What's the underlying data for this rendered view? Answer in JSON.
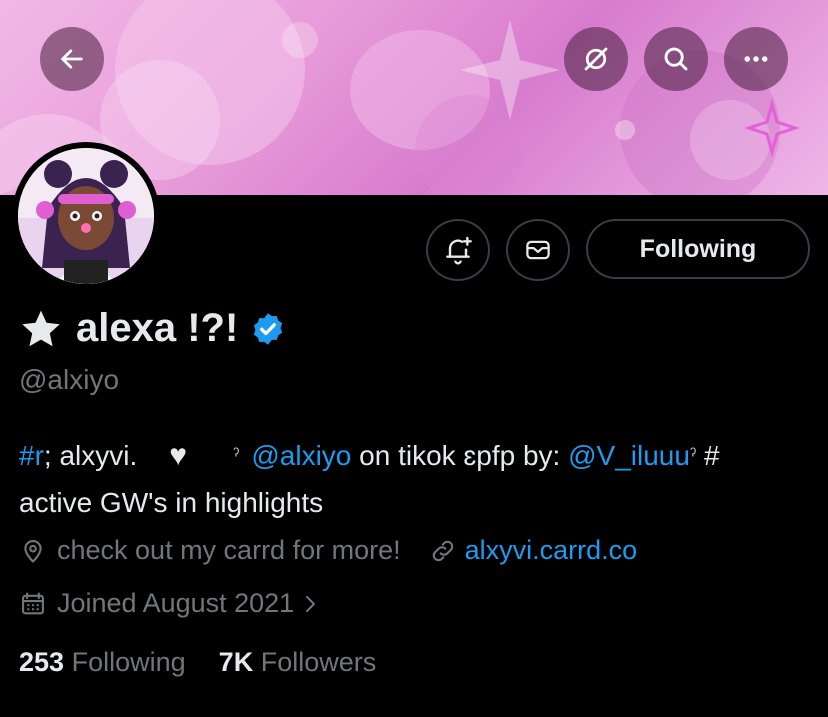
{
  "header": {
    "back_icon": "arrow-left-icon",
    "grok_icon": "slashed-circle-icon",
    "search_icon": "search-icon",
    "more_icon": "more-dots-icon"
  },
  "profile": {
    "name": "alexa !?!",
    "name_prefix_icon": "star-icon",
    "verified_icon": "verified-badge-icon",
    "handle": "@alxiyo",
    "following_label": "Following",
    "notify_icon": "bell-plus-icon",
    "message_icon": "envelope-icon"
  },
  "bio": {
    "hashtag_r": "#r",
    "text1": "; alxyvi.",
    "heart": "♥",
    "sep1": "ˀ",
    "mention1": "@alxiyo",
    "text2": " on tikok ɛpfp by: ",
    "mention2": "@V_iluuu",
    "sep2": "ˀ",
    "text3": " #",
    "line2": "active GW's in highlights"
  },
  "meta": {
    "location_icon": "location-pin-icon",
    "location": "check out my carrd for more!",
    "link_icon": "link-icon",
    "link": "alxyvi.carrd.co",
    "calendar_icon": "calendar-icon",
    "joined": "Joined August 2021",
    "chevron_icon": "chevron-right-icon"
  },
  "stats": {
    "following_count": "253",
    "following_label": "Following",
    "followers_count": "7K",
    "followers_label": "Followers"
  },
  "colors": {
    "accent": "#1d9bf0",
    "muted": "#71767b",
    "text": "#e7e9ea",
    "banner_pink": "#e79ad9"
  }
}
